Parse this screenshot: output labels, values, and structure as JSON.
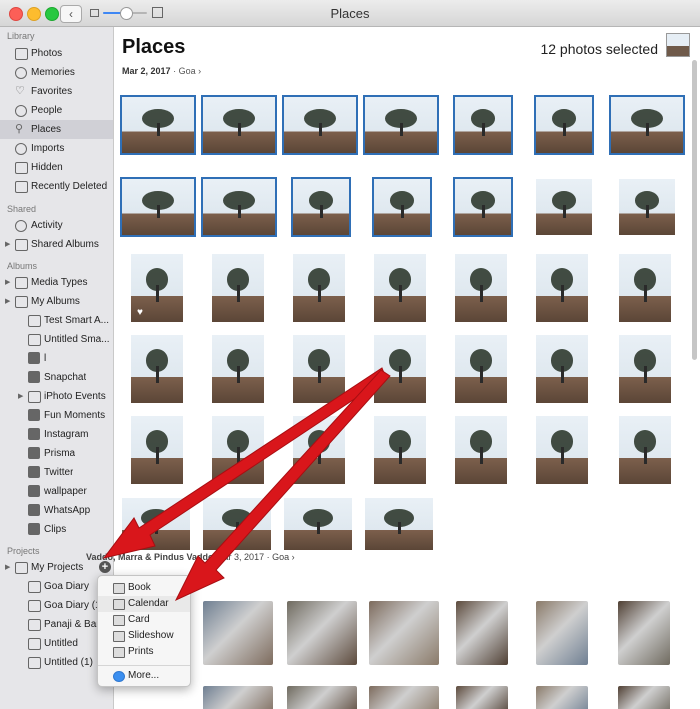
{
  "window": {
    "title": "Places"
  },
  "sidebar": {
    "sections": [
      {
        "label": "Library",
        "items": [
          {
            "label": "Photos",
            "icon": "photos-icon",
            "selected": false
          },
          {
            "label": "Memories",
            "icon": "memories-icon",
            "selected": false
          },
          {
            "label": "Favorites",
            "icon": "heart-icon",
            "selected": false
          },
          {
            "label": "People",
            "icon": "person-icon",
            "selected": false
          },
          {
            "label": "Places",
            "icon": "pin-icon",
            "selected": true
          },
          {
            "label": "Imports",
            "icon": "clock-icon",
            "selected": false
          },
          {
            "label": "Hidden",
            "icon": "eye-slash-icon",
            "selected": false
          },
          {
            "label": "Recently Deleted",
            "icon": "trash-icon",
            "selected": false
          }
        ]
      },
      {
        "label": "Shared",
        "items": [
          {
            "label": "Activity",
            "icon": "cloud-icon",
            "selected": false
          },
          {
            "label": "Shared Albums",
            "icon": "folder-icon",
            "selected": false
          }
        ]
      },
      {
        "label": "Albums",
        "items": [
          {
            "label": "Media Types",
            "icon": "folder-icon",
            "selected": false
          },
          {
            "label": "My Albums",
            "icon": "folder-icon",
            "selected": false
          },
          {
            "label": "Test Smart A...",
            "icon": "gear-icon",
            "selected": false
          },
          {
            "label": "Untitled Sma...",
            "icon": "gear-icon",
            "selected": false
          },
          {
            "label": "l",
            "icon": "album-icon",
            "selected": false
          },
          {
            "label": "Snapchat",
            "icon": "album-icon",
            "selected": false
          },
          {
            "label": "iPhoto Events",
            "icon": "folder-icon",
            "selected": false
          },
          {
            "label": "Fun Moments",
            "icon": "album-icon",
            "selected": false
          },
          {
            "label": "Instagram",
            "icon": "album-icon",
            "selected": false
          },
          {
            "label": "Prisma",
            "icon": "album-icon",
            "selected": false
          },
          {
            "label": "Twitter",
            "icon": "album-icon",
            "selected": false
          },
          {
            "label": "wallpaper",
            "icon": "album-icon",
            "selected": false
          },
          {
            "label": "WhatsApp",
            "icon": "album-icon",
            "selected": false
          },
          {
            "label": "Clips",
            "icon": "album-icon",
            "selected": false
          }
        ]
      },
      {
        "label": "Projects",
        "items": [
          {
            "label": "My Projects",
            "icon": "folder-icon",
            "selected": false
          },
          {
            "label": "Goa Diary",
            "icon": "book-icon",
            "selected": false
          },
          {
            "label": "Goa Diary (1)",
            "icon": "book-icon",
            "selected": false
          },
          {
            "label": "Panaji & Barc",
            "icon": "book-icon",
            "selected": false
          },
          {
            "label": "Untitled",
            "icon": "book-icon",
            "selected": false
          },
          {
            "label": "Untitled (1)",
            "icon": "book-icon",
            "selected": false
          }
        ]
      }
    ]
  },
  "main": {
    "title": "Places",
    "selection_status": "12 photos selected",
    "moment1": {
      "date": "Mar 2, 2017",
      "location": "Goa",
      "chevron": "›"
    },
    "moment2": {
      "places": "Vaddo, Marra & Pindus Vaddo",
      "date": "Mar 3, 2017",
      "location": "Goa",
      "chevron": "›"
    }
  },
  "project_menu": {
    "items": [
      {
        "label": "Book",
        "icon": "book-icon"
      },
      {
        "label": "Calendar",
        "icon": "calendar-icon"
      },
      {
        "label": "Card",
        "icon": "card-icon"
      },
      {
        "label": "Slideshow",
        "icon": "slideshow-icon"
      },
      {
        "label": "Prints",
        "icon": "prints-icon"
      }
    ],
    "more_label": "More...",
    "more_icon": "app-store-icon"
  },
  "colors": {
    "accent": "#2f6fb6",
    "arrow": "#d9161b",
    "selection": "#d0d0d6"
  },
  "misc": {
    "back_symbol": "‹",
    "plus_symbol": "+",
    "dot": "·",
    "heart": "♥"
  }
}
